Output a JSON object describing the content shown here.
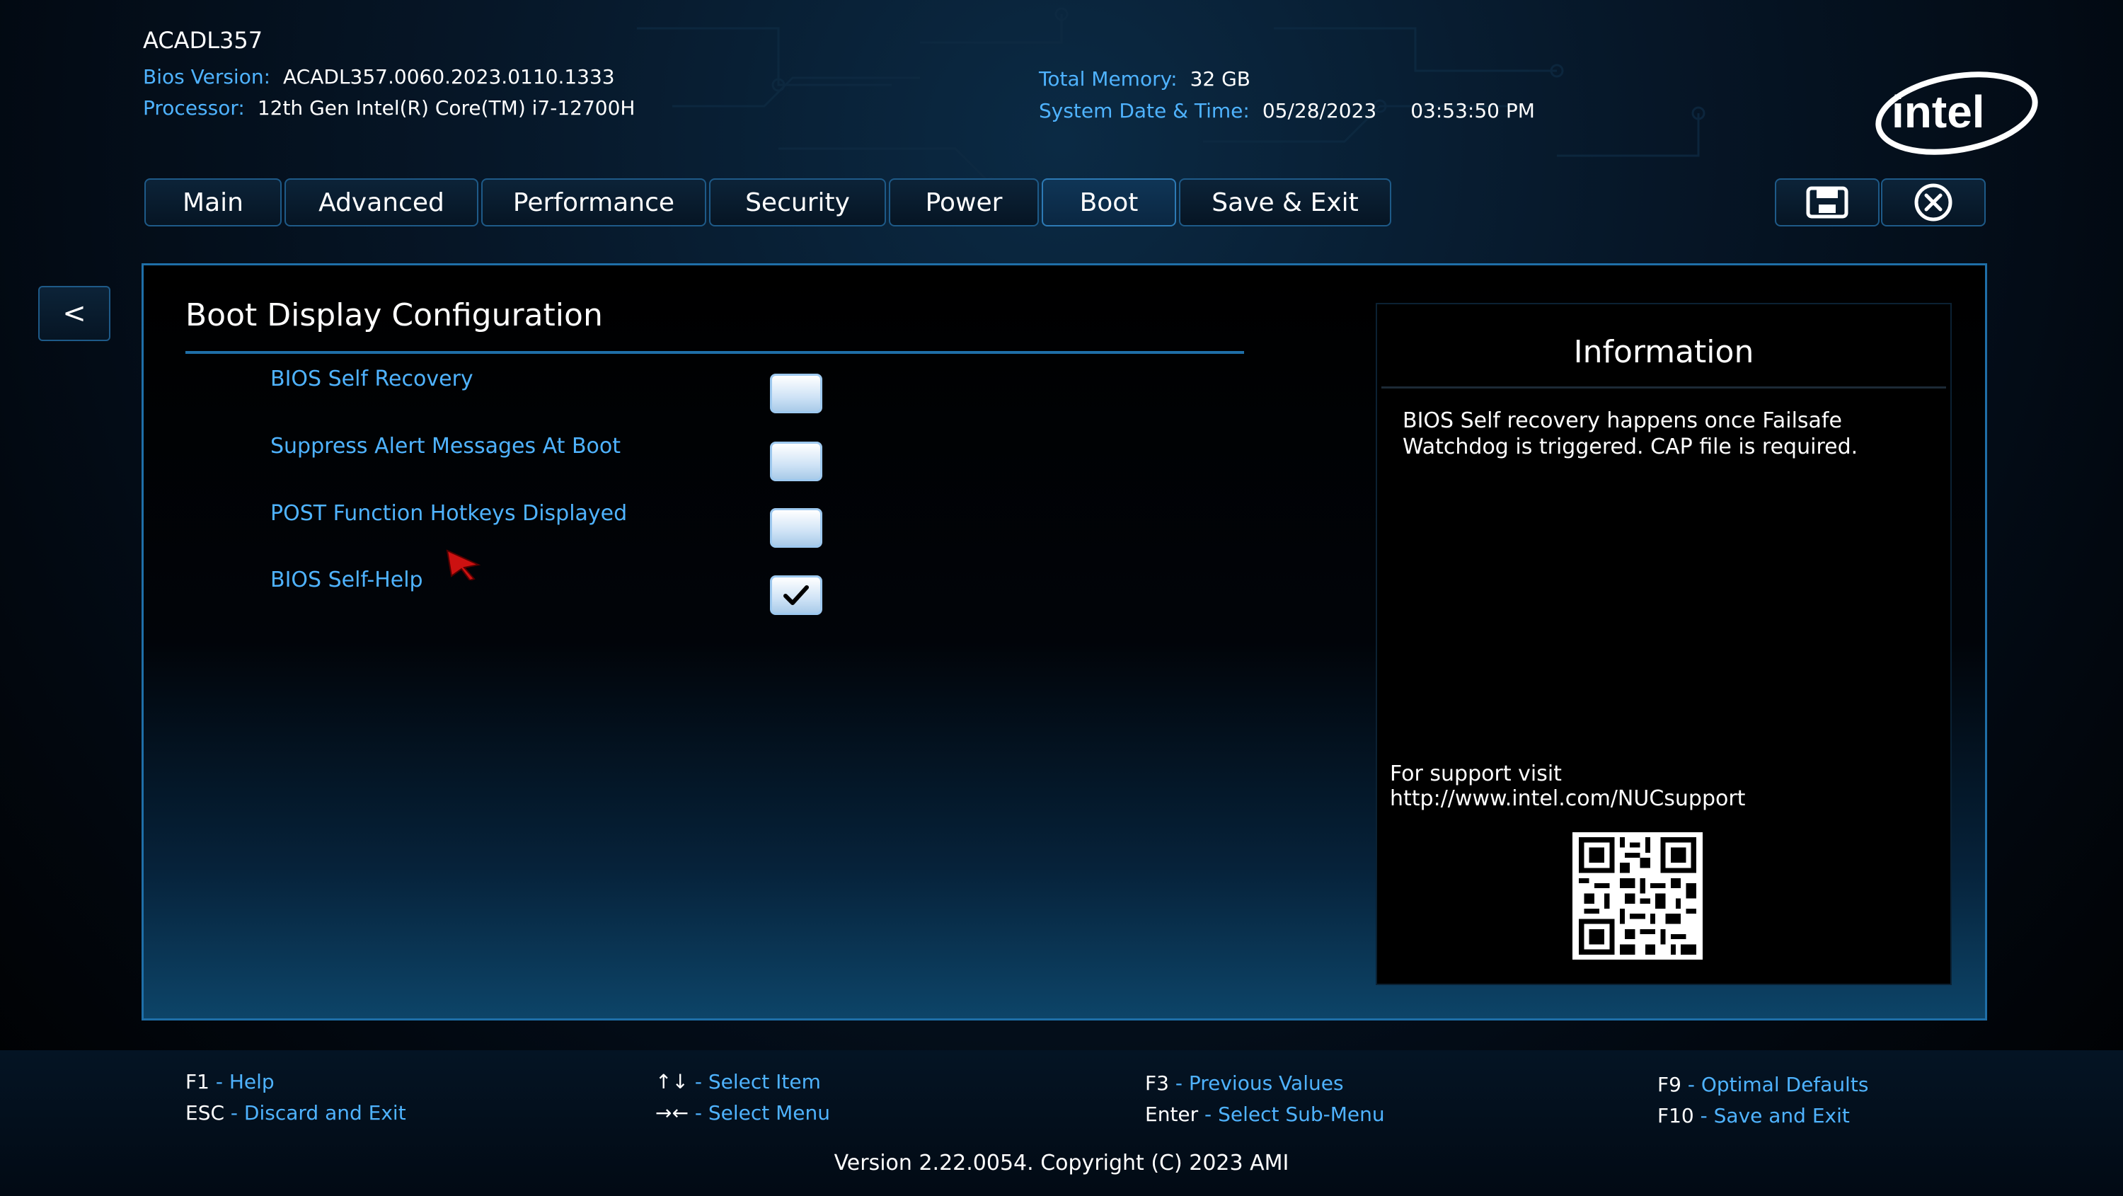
{
  "header": {
    "system_name": "ACADL357",
    "bios_version_label": "Bios Version:",
    "bios_version": "ACADL357.0060.2023.0110.1333",
    "processor_label": "Processor:",
    "processor": "12th Gen Intel(R) Core(TM) i7-12700H",
    "total_memory_label": "Total Memory:",
    "total_memory": "32 GB",
    "datetime_label": "System Date & Time:",
    "date": "05/28/2023",
    "time": "03:53:50 PM",
    "logo_text": "intel"
  },
  "tabs": [
    {
      "label": "Main",
      "active": false
    },
    {
      "label": "Advanced",
      "active": false
    },
    {
      "label": "Performance",
      "active": false
    },
    {
      "label": "Security",
      "active": false
    },
    {
      "label": "Power",
      "active": false
    },
    {
      "label": "Boot",
      "active": true
    },
    {
      "label": "Save & Exit",
      "active": false
    }
  ],
  "toolbar": {
    "save_icon": "save-icon",
    "exit_icon": "close-circle-icon"
  },
  "back_button_label": "<",
  "section": {
    "title": "Boot Display Configuration",
    "options": [
      {
        "label": "BIOS Self Recovery",
        "checked": false
      },
      {
        "label": "Suppress Alert Messages At Boot",
        "checked": false
      },
      {
        "label": "POST Function Hotkeys Displayed",
        "checked": false
      },
      {
        "label": "BIOS Self-Help",
        "checked": true
      }
    ]
  },
  "info": {
    "title": "Information",
    "text_line1": "BIOS Self recovery happens once Failsafe",
    "text_line2": "Watchdog is triggered. CAP file is required.",
    "support_line1": "For support visit",
    "support_line2": "http://www.intel.com/NUCsupport"
  },
  "footer": {
    "keys": [
      {
        "key": "F1",
        "desc": "Help"
      },
      {
        "key": "ESC",
        "desc": "Discard and Exit"
      },
      {
        "key": "↑↓",
        "desc": "Select Item"
      },
      {
        "key": "→←",
        "desc": "Select Menu"
      },
      {
        "key": "F3",
        "desc": "Previous Values"
      },
      {
        "key": "Enter",
        "desc": "Select Sub-Menu"
      },
      {
        "key": "F9",
        "desc": "Optimal Defaults"
      },
      {
        "key": "F10",
        "desc": "Save and Exit"
      }
    ],
    "version": "Version 2.22.0054. Copyright (C) 2023 AMI"
  },
  "colors": {
    "accent_blue": "#4fb3ff",
    "border_blue": "#1f6fa8",
    "text_white": "#ffffff"
  }
}
